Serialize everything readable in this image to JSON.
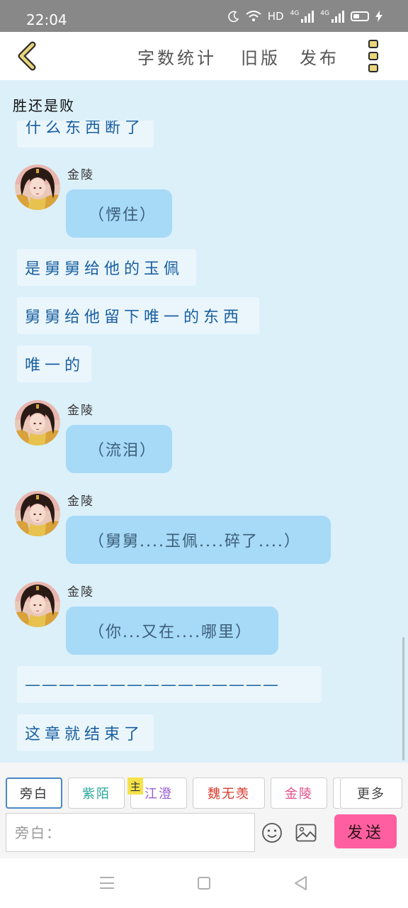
{
  "status_bar": {
    "time": "22:04",
    "network": "HD",
    "sim1": "4G",
    "sim2": "4G"
  },
  "toolbar": {
    "word_count": "字数统计",
    "old_version": "旧版",
    "publish": "发布"
  },
  "chat": {
    "title": "胜还是败",
    "clipped_message": "什么东西断了",
    "messages": [
      {
        "type": "character",
        "sender": "金陵",
        "text": "（愣住）"
      },
      {
        "type": "narration",
        "text": "是舅舅给他的玉佩"
      },
      {
        "type": "narration",
        "text": "舅舅给他留下唯一的东西"
      },
      {
        "type": "narration",
        "text": "唯一的"
      },
      {
        "type": "character",
        "sender": "金陵",
        "text": "（流泪）"
      },
      {
        "type": "character",
        "sender": "金陵",
        "text": "（舅舅....玉佩....碎了....）"
      },
      {
        "type": "character",
        "sender": "金陵",
        "text": "（你...又在....哪里）"
      },
      {
        "type": "narration",
        "text": "———————————————"
      },
      {
        "type": "narration",
        "text": "这章就结束了"
      }
    ]
  },
  "roles": [
    {
      "label": "旁白",
      "color": "#333333"
    },
    {
      "label": "紫陌",
      "color": "#2aa79b"
    },
    {
      "label": "江澄",
      "color": "#9a5fd0"
    },
    {
      "label": "魏无羡",
      "color": "#d83a2e"
    },
    {
      "label": "金陵",
      "color": "#e0508a"
    },
    {
      "label": "更多",
      "color": "#444444"
    }
  ],
  "main_badge": "主",
  "input": {
    "placeholder": "旁白："
  },
  "send_label": "发送",
  "colors": {
    "bubble": "#a6daf7",
    "narration_bg": "#eaf6fc",
    "narration_text": "#1a5fa0",
    "chat_bg": "#dcf0fa",
    "send": "#ff5fa0",
    "accent": "#4a87c8"
  },
  "icons": [
    "back-chevron-icon",
    "more-vertical-icon",
    "emoji-icon",
    "image-icon",
    "menu-icon",
    "home-icon",
    "back-triangle-icon"
  ]
}
